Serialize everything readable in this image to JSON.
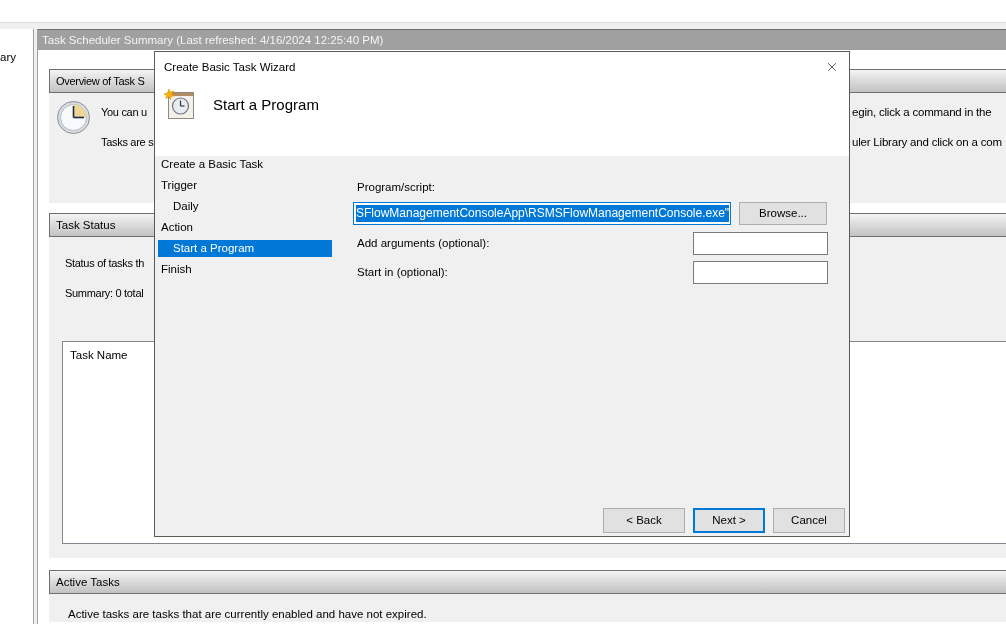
{
  "left_pane": {
    "tree_item": "ary"
  },
  "summary": {
    "title": "Task Scheduler Summary (Last refreshed: 4/16/2024 12:25:40 PM)",
    "sections": [
      {
        "kind": "overview",
        "title": "Overview of Task S",
        "lines": [
          {
            "left": "You can u",
            "right": "egin, click a command in the"
          },
          {
            "left": "Tasks are s",
            "right": "uler Library and click on a com"
          }
        ]
      },
      {
        "kind": "status",
        "title": "Task Status",
        "lines": [
          "Status of tasks th",
          "Summary: 0 total"
        ],
        "table": {
          "columns": [
            "Task Name"
          ]
        }
      },
      {
        "kind": "active",
        "title": "Active Tasks",
        "lines": [
          "Active tasks are tasks that are currently enabled and have not expired."
        ]
      }
    ]
  },
  "dialog": {
    "title": "Create Basic Task Wizard",
    "heading": "Start a Program",
    "steps": [
      {
        "label": "Create a Basic Task",
        "selected": false
      },
      {
        "label": "Trigger",
        "selected": false,
        "children": [
          {
            "label": "Daily",
            "selected": false
          }
        ]
      },
      {
        "label": "Action",
        "selected": false,
        "children": [
          {
            "label": "Start a Program",
            "selected": true
          }
        ]
      },
      {
        "label": "Finish",
        "selected": false
      }
    ],
    "fields": [
      {
        "kind": "path",
        "label": "Program/script:",
        "value": "SFlowManagementConsoleApp\\RSMSFlowManagementConsole.exe\"",
        "focused": true
      },
      {
        "kind": "text",
        "label": "Add arguments (optional):",
        "focused": false
      },
      {
        "kind": "text",
        "label": "Start in (optional):",
        "focused": false
      }
    ],
    "browse_button": "Browse...",
    "buttons": [
      {
        "label": "< Back",
        "default": false
      },
      {
        "label": "Next >",
        "default": true
      },
      {
        "label": "Cancel",
        "default": false
      }
    ]
  }
}
